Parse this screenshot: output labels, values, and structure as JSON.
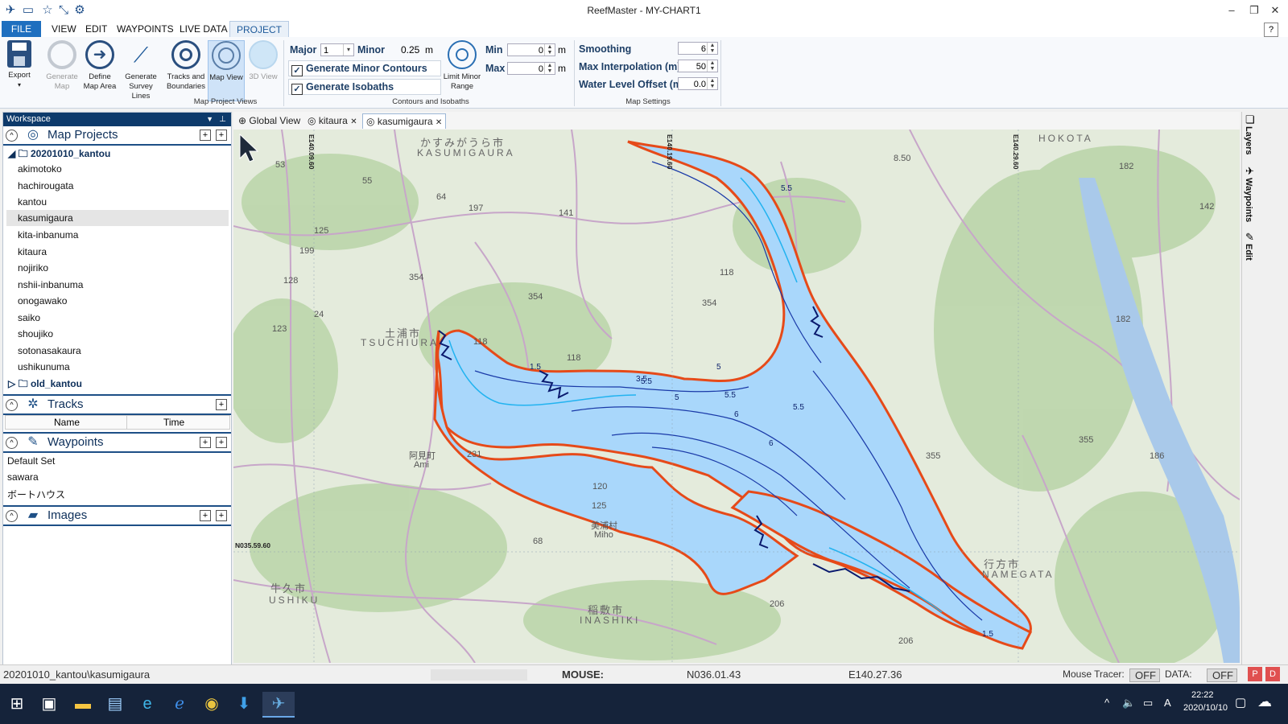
{
  "app": {
    "title": "ReefMaster - MY-CHART1"
  },
  "menu": {
    "tabs": [
      "FILE",
      "VIEW",
      "EDIT",
      "WAYPOINTS",
      "LIVE DATA",
      "PROJECT"
    ],
    "help": "?"
  },
  "ribbon": {
    "export": "Export",
    "generate_map": "Generate Map",
    "define_map_area": "Define Map Area",
    "generate_survey_lines": "Generate Survey Lines",
    "tracks_boundaries": "Tracks and Boundaries",
    "map_view": "Map View",
    "view_3d": "3D View",
    "group_views": "Map Project Views",
    "major_label": "Major",
    "major_value": "1",
    "minor_label": "Minor",
    "minor_value": "0.25",
    "unit_m": "m",
    "gen_minor_contours": "Generate Minor Contours",
    "gen_isobaths": "Generate Isobaths",
    "limit_minor_range": "Limit Minor Range",
    "min_label": "Min",
    "min_value": "0",
    "max_label": "Max",
    "max_value": "0",
    "group_contours": "Contours and Isobaths",
    "smoothing_label": "Smoothing",
    "smoothing_value": "6",
    "max_interp_label": "Max Interpolation (m)",
    "max_interp_value": "50",
    "water_level_label": "Water Level Offset (m)",
    "water_level_value": "0.0",
    "group_map_settings": "Map Settings"
  },
  "workspace": {
    "title": "Workspace",
    "map_projects": {
      "title": "Map Projects",
      "folder": "20201010_kantou",
      "items": [
        "akimotoko",
        "hachirougata",
        "kantou",
        "kasumigaura",
        "kita-inbanuma",
        "kitaura",
        "nojiriko",
        "nshii-inbanuma",
        "onogawako",
        "saiko",
        "shoujiko",
        "sotonasakaura",
        "ushikunuma"
      ],
      "selected": "kasumigaura",
      "old_folder": "old_kantou"
    },
    "tracks": {
      "title": "Tracks",
      "col_name": "Name",
      "col_time": "Time"
    },
    "waypoints": {
      "title": "Waypoints",
      "items": [
        "Default Set",
        "sawara",
        "ボートハウス"
      ]
    },
    "images": {
      "title": "Images"
    }
  },
  "doc_tabs": [
    {
      "label": "Global View",
      "closable": false
    },
    {
      "label": "kitaura",
      "closable": true
    },
    {
      "label": "kasumigaura",
      "closable": true,
      "active": true
    }
  ],
  "map": {
    "grid_labels": {
      "lon1": "E140.09.60",
      "lon2": "E140.19.60",
      "lon3": "E140.29.60",
      "lat1": "N035.59.60"
    },
    "places": {
      "kasumigaura_jp": "かすみがうら市",
      "kasumigaura_en": "KASUMIGAURA",
      "tsuchiura_jp": "土浦市",
      "tsuchiura_en": "TSUCHIURA",
      "ami_jp": "阿見町",
      "ami_en": "Ami",
      "miho_jp": "美浦村",
      "miho_en": "Miho",
      "ushiku_jp": "牛久市",
      "ushiku_en": "USHIKU",
      "inashiki_jp": "稲敷市",
      "inashiki_en": "INASHIKI",
      "namegata_jp": "行方市",
      "namegata_en": "NAMEGATA",
      "hokota_en": "HOKOTA"
    },
    "depths": [
      "5.5",
      "5.5",
      "5",
      "6",
      "6",
      "5.5",
      "5",
      "5.5",
      "1.5",
      "3.5",
      "1.5"
    ],
    "road_numbers": [
      "53",
      "55",
      "64",
      "141",
      "197",
      "125",
      "199",
      "128",
      "24",
      "354",
      "123",
      "118",
      "118",
      "354",
      "354",
      "231",
      "125",
      "120",
      "68",
      "206",
      "206",
      "8.50",
      "182",
      "142",
      "182",
      "355",
      "355",
      "186",
      "118"
    ]
  },
  "side_panels": [
    "Layers",
    "Waypoints",
    "Edit"
  ],
  "status": {
    "path": "20201010_kantou\\kasumigaura",
    "mouse_label": "MOUSE:",
    "lat": "N036.01.43",
    "lon": "E140.27.36",
    "mouse_tracer_label": "Mouse Tracer:",
    "tracer_state": "OFF",
    "data_label": "DATA:",
    "data_state": "OFF",
    "p_btn": "P",
    "d_btn": "D"
  },
  "taskbar": {
    "time": "22:22",
    "date": "2020/10/10",
    "ime": "A"
  }
}
